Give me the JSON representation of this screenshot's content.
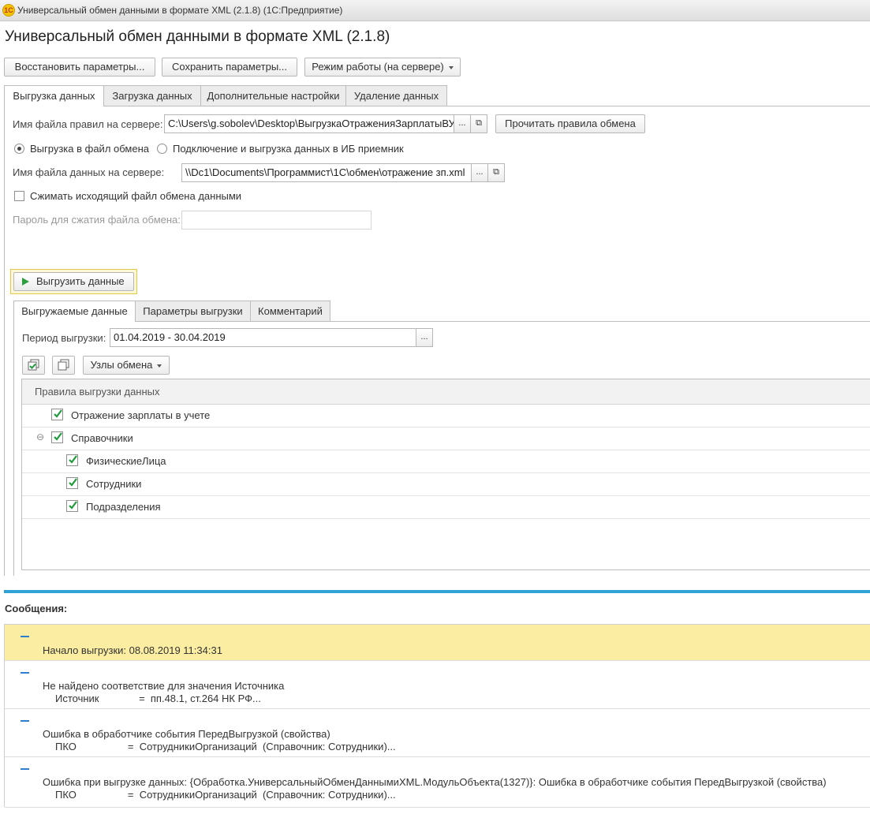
{
  "window": {
    "title": "Универсальный обмен данными в формате XML (2.1.8)  (1С:Предприятие)"
  },
  "page": {
    "title": "Универсальный обмен данными в формате XML (2.1.8)"
  },
  "toolbar": {
    "restore_label": "Восстановить параметры...",
    "save_label": "Сохранить параметры...",
    "mode_label": "Режим работы (на сервере)"
  },
  "tabs": [
    {
      "label": "Выгрузка данных"
    },
    {
      "label": "Загрузка данных"
    },
    {
      "label": "Дополнительные настройки"
    },
    {
      "label": "Удаление данных"
    }
  ],
  "export": {
    "rules_file_label": "Имя файла правил на сервере:",
    "rules_file_value": "C:\\Users\\g.sobolev\\Desktop\\ВыгрузкаОтраженияЗарплатыВУ",
    "read_rules_label": "Прочитать правила обмена",
    "radio_file_label": "Выгрузка в файл обмена",
    "radio_ib_label": "Подключение и выгрузка данных в ИБ приемник",
    "data_file_label": "Имя файла данных на сервере:",
    "data_file_value": "\\\\Dc1\\Documents\\Программист\\1С\\обмен\\отражение зп.xml",
    "compress_label": "Сжимать исходящий файл обмена данными",
    "password_label": "Пароль для сжатия файла обмена:",
    "password_value": "",
    "export_button_label": "Выгрузить данные",
    "ellipsis": "...",
    "open_glyph": "⧉"
  },
  "subtabs": [
    {
      "label": "Выгружаемые данные"
    },
    {
      "label": "Параметры выгрузки"
    },
    {
      "label": "Комментарий"
    }
  ],
  "exported": {
    "period_label": "Период выгрузки:",
    "period_value": "01.04.2019 - 30.04.2019",
    "nodes_label": "Узлы обмена",
    "table_header": "Правила выгрузки данных",
    "rows": [
      {
        "label": "Отражение зарплаты в учете",
        "checked": true
      },
      {
        "label": "Справочники",
        "checked": true,
        "collapse": "⊖"
      },
      {
        "label": "ФизическиеЛица",
        "checked": true
      },
      {
        "label": "Сотрудники",
        "checked": true
      },
      {
        "label": "Подразделения",
        "checked": true
      }
    ]
  },
  "messages": {
    "title": "Сообщения:",
    "items": [
      {
        "lines": [
          "Начало выгрузки: 08.08.2019 11:34:31"
        ]
      },
      {
        "lines": [
          "Не найдено соответствие для значения Источника",
          "Источник              =  пп.48.1, ст.264 НК РФ..."
        ]
      },
      {
        "lines": [
          "Ошибка в обработчике события ПередВыгрузкой (свойства)",
          "ПКО                  =  СотрудникиОрганизаций  (Справочник: Сотрудники)..."
        ]
      },
      {
        "lines": [
          "Ошибка при выгрузке данных: {Обработка.УниверсальныйОбменДаннымиXML.МодульОбъекта(1327)}: Ошибка в обработчике события ПередВыгрузкой (свойства)",
          "ПКО                  =  СотрудникиОрганизаций  (Справочник: Сотрудники)..."
        ]
      }
    ]
  },
  "colors": {
    "accent_blue": "#2fa2d6",
    "highlight_yellow": "#fbeea3",
    "check_green": "#1f9a3a"
  }
}
